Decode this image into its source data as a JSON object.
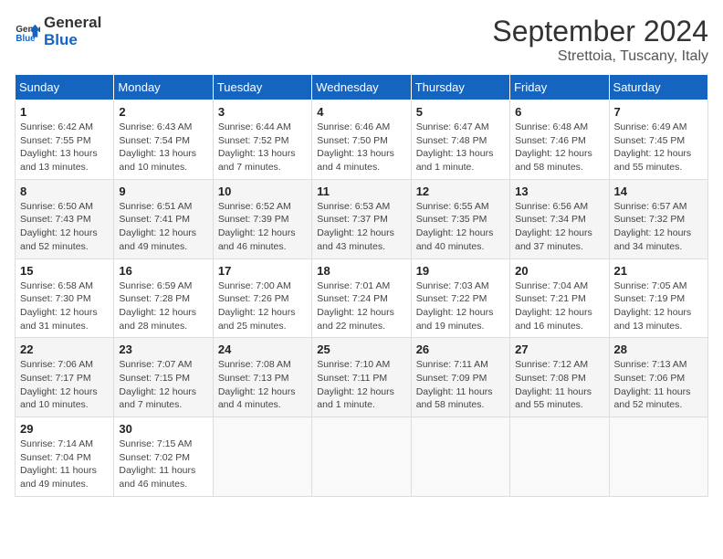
{
  "header": {
    "logo_line1": "General",
    "logo_line2": "Blue",
    "month": "September 2024",
    "location": "Strettoia, Tuscany, Italy"
  },
  "days_of_week": [
    "Sunday",
    "Monday",
    "Tuesday",
    "Wednesday",
    "Thursday",
    "Friday",
    "Saturday"
  ],
  "weeks": [
    [
      {
        "day": "1",
        "info": "Sunrise: 6:42 AM\nSunset: 7:55 PM\nDaylight: 13 hours\nand 13 minutes."
      },
      {
        "day": "2",
        "info": "Sunrise: 6:43 AM\nSunset: 7:54 PM\nDaylight: 13 hours\nand 10 minutes."
      },
      {
        "day": "3",
        "info": "Sunrise: 6:44 AM\nSunset: 7:52 PM\nDaylight: 13 hours\nand 7 minutes."
      },
      {
        "day": "4",
        "info": "Sunrise: 6:46 AM\nSunset: 7:50 PM\nDaylight: 13 hours\nand 4 minutes."
      },
      {
        "day": "5",
        "info": "Sunrise: 6:47 AM\nSunset: 7:48 PM\nDaylight: 13 hours\nand 1 minute."
      },
      {
        "day": "6",
        "info": "Sunrise: 6:48 AM\nSunset: 7:46 PM\nDaylight: 12 hours\nand 58 minutes."
      },
      {
        "day": "7",
        "info": "Sunrise: 6:49 AM\nSunset: 7:45 PM\nDaylight: 12 hours\nand 55 minutes."
      }
    ],
    [
      {
        "day": "8",
        "info": "Sunrise: 6:50 AM\nSunset: 7:43 PM\nDaylight: 12 hours\nand 52 minutes."
      },
      {
        "day": "9",
        "info": "Sunrise: 6:51 AM\nSunset: 7:41 PM\nDaylight: 12 hours\nand 49 minutes."
      },
      {
        "day": "10",
        "info": "Sunrise: 6:52 AM\nSunset: 7:39 PM\nDaylight: 12 hours\nand 46 minutes."
      },
      {
        "day": "11",
        "info": "Sunrise: 6:53 AM\nSunset: 7:37 PM\nDaylight: 12 hours\nand 43 minutes."
      },
      {
        "day": "12",
        "info": "Sunrise: 6:55 AM\nSunset: 7:35 PM\nDaylight: 12 hours\nand 40 minutes."
      },
      {
        "day": "13",
        "info": "Sunrise: 6:56 AM\nSunset: 7:34 PM\nDaylight: 12 hours\nand 37 minutes."
      },
      {
        "day": "14",
        "info": "Sunrise: 6:57 AM\nSunset: 7:32 PM\nDaylight: 12 hours\nand 34 minutes."
      }
    ],
    [
      {
        "day": "15",
        "info": "Sunrise: 6:58 AM\nSunset: 7:30 PM\nDaylight: 12 hours\nand 31 minutes."
      },
      {
        "day": "16",
        "info": "Sunrise: 6:59 AM\nSunset: 7:28 PM\nDaylight: 12 hours\nand 28 minutes."
      },
      {
        "day": "17",
        "info": "Sunrise: 7:00 AM\nSunset: 7:26 PM\nDaylight: 12 hours\nand 25 minutes."
      },
      {
        "day": "18",
        "info": "Sunrise: 7:01 AM\nSunset: 7:24 PM\nDaylight: 12 hours\nand 22 minutes."
      },
      {
        "day": "19",
        "info": "Sunrise: 7:03 AM\nSunset: 7:22 PM\nDaylight: 12 hours\nand 19 minutes."
      },
      {
        "day": "20",
        "info": "Sunrise: 7:04 AM\nSunset: 7:21 PM\nDaylight: 12 hours\nand 16 minutes."
      },
      {
        "day": "21",
        "info": "Sunrise: 7:05 AM\nSunset: 7:19 PM\nDaylight: 12 hours\nand 13 minutes."
      }
    ],
    [
      {
        "day": "22",
        "info": "Sunrise: 7:06 AM\nSunset: 7:17 PM\nDaylight: 12 hours\nand 10 minutes."
      },
      {
        "day": "23",
        "info": "Sunrise: 7:07 AM\nSunset: 7:15 PM\nDaylight: 12 hours\nand 7 minutes."
      },
      {
        "day": "24",
        "info": "Sunrise: 7:08 AM\nSunset: 7:13 PM\nDaylight: 12 hours\nand 4 minutes."
      },
      {
        "day": "25",
        "info": "Sunrise: 7:10 AM\nSunset: 7:11 PM\nDaylight: 12 hours\nand 1 minute."
      },
      {
        "day": "26",
        "info": "Sunrise: 7:11 AM\nSunset: 7:09 PM\nDaylight: 11 hours\nand 58 minutes."
      },
      {
        "day": "27",
        "info": "Sunrise: 7:12 AM\nSunset: 7:08 PM\nDaylight: 11 hours\nand 55 minutes."
      },
      {
        "day": "28",
        "info": "Sunrise: 7:13 AM\nSunset: 7:06 PM\nDaylight: 11 hours\nand 52 minutes."
      }
    ],
    [
      {
        "day": "29",
        "info": "Sunrise: 7:14 AM\nSunset: 7:04 PM\nDaylight: 11 hours\nand 49 minutes."
      },
      {
        "day": "30",
        "info": "Sunrise: 7:15 AM\nSunset: 7:02 PM\nDaylight: 11 hours\nand 46 minutes."
      },
      {
        "day": "",
        "info": ""
      },
      {
        "day": "",
        "info": ""
      },
      {
        "day": "",
        "info": ""
      },
      {
        "day": "",
        "info": ""
      },
      {
        "day": "",
        "info": ""
      }
    ]
  ]
}
